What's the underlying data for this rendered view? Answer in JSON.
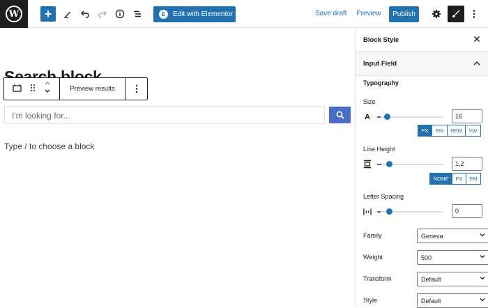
{
  "topbar": {
    "elementor_label": "Edit with Elementor",
    "save_draft": "Save draft",
    "preview": "Preview",
    "publish": "Publish"
  },
  "editor": {
    "heading": "Search block",
    "block_toolbar": {
      "preview_results": "Preview results"
    },
    "search": {
      "placeholder": "I'm looking for..."
    },
    "hint": "Type / to choose a block"
  },
  "sidebar": {
    "title": "Block Style",
    "section": "Input Field",
    "group": "Typography",
    "size": {
      "label": "Size",
      "value": "16",
      "units": [
        "PX",
        "EM",
        "REM",
        "VW"
      ],
      "active_unit": "PX"
    },
    "line_height": {
      "label": "Line Height",
      "value": "1,2",
      "units": [
        "NONE",
        "PX",
        "EM"
      ],
      "active_unit": "NONE"
    },
    "letter_spacing": {
      "label": "Letter Spacing",
      "value": "0"
    },
    "family": {
      "label": "Family",
      "value": "Geneva"
    },
    "weight": {
      "label": "Weight",
      "value": "500"
    },
    "transform": {
      "label": "Transform",
      "value": "Default"
    },
    "style": {
      "label": "Style",
      "value": "Default"
    }
  },
  "colors": {
    "accent": "#2271b1",
    "search_button": "#4a6ec7",
    "dark": "#1e1e1e"
  }
}
